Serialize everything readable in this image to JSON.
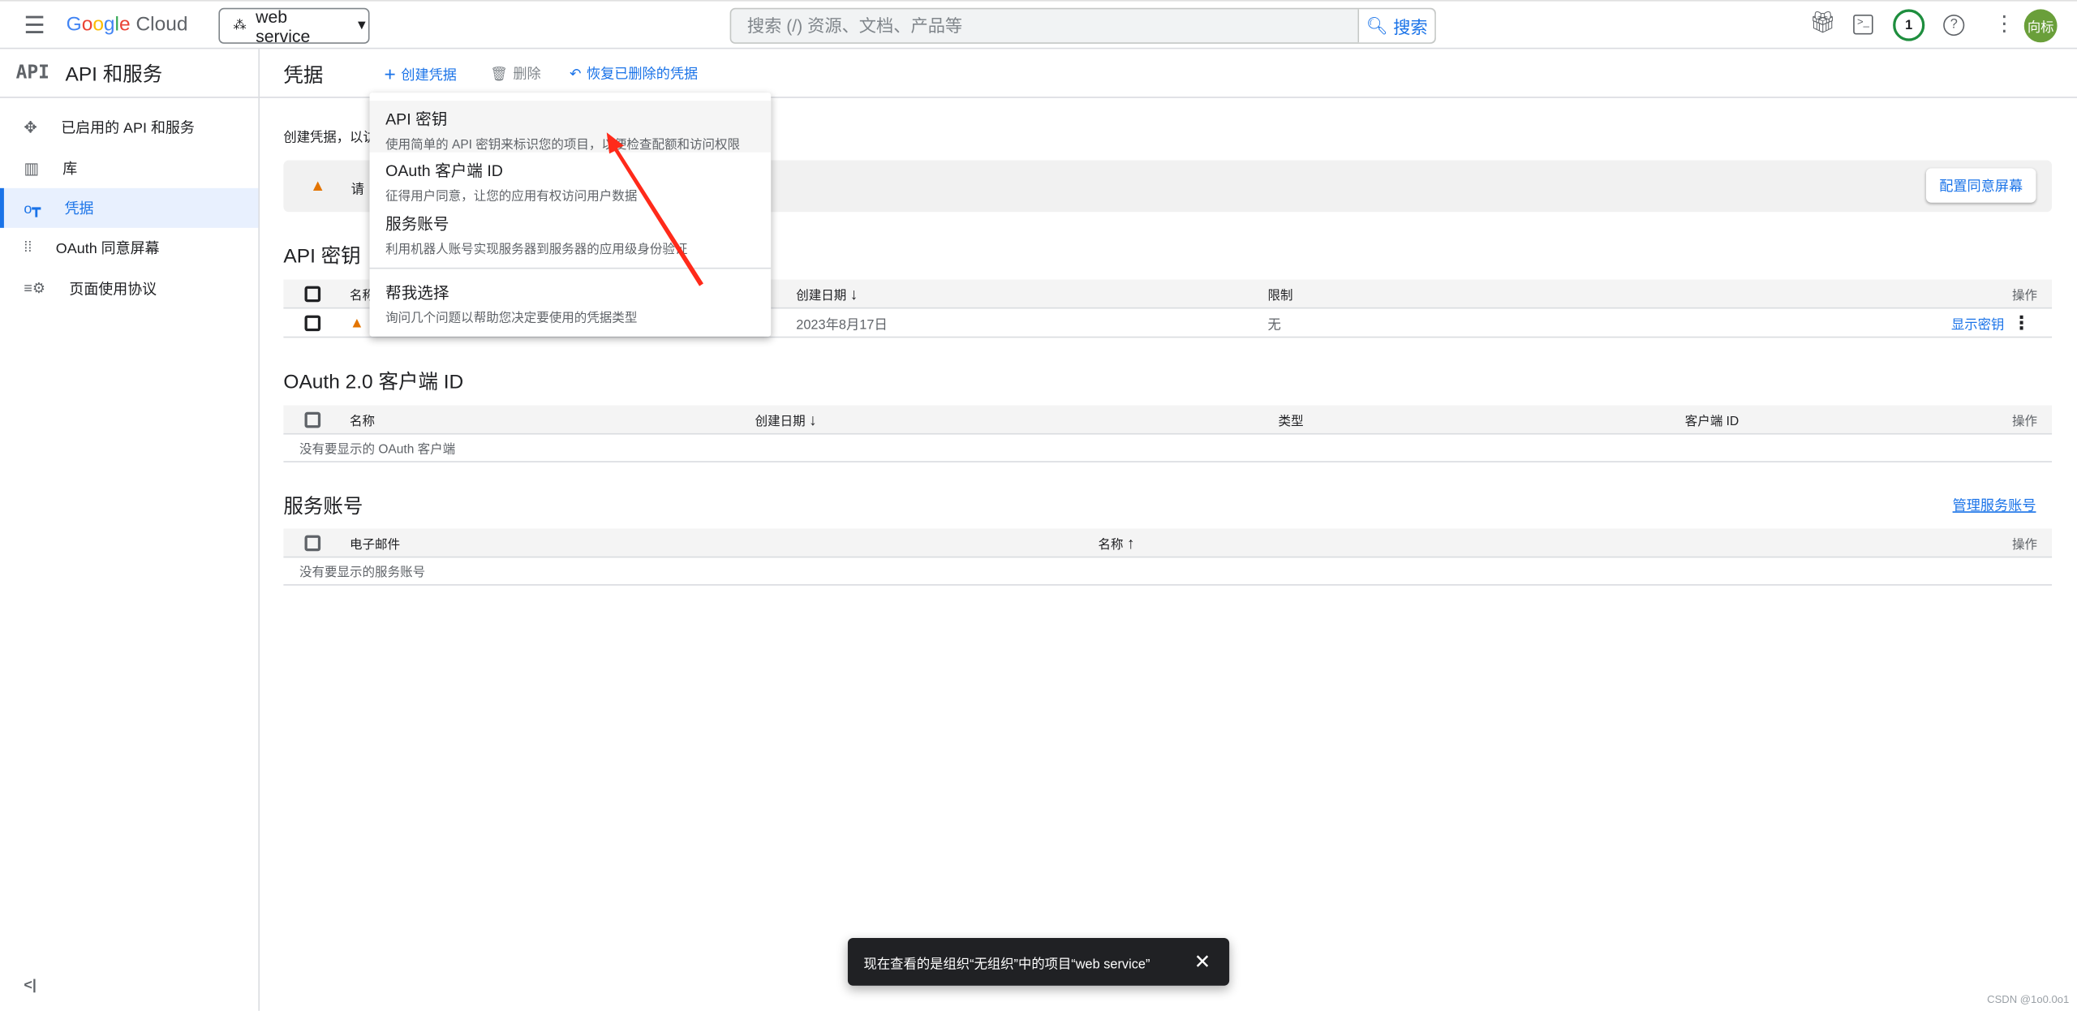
{
  "topbar": {
    "brand": "Google Cloud",
    "project": "web service",
    "search_placeholder": "搜索 (/) 资源、文档、产品等",
    "search_button": "搜索",
    "notification_count": "1",
    "avatar_text": "向标",
    "icons": [
      "menu-icon",
      "gift-icon",
      "terminal-icon",
      "help-icon",
      "more-vert-icon"
    ]
  },
  "sidebar": {
    "logo": "API",
    "title": "API 和服务",
    "items": [
      {
        "label": "已启用的 API 和服务",
        "icon": "enabled-apis-icon"
      },
      {
        "label": "库",
        "icon": "library-icon"
      },
      {
        "label": "凭据",
        "icon": "key-icon",
        "active": true
      },
      {
        "label": "OAuth 同意屏幕",
        "icon": "oauth-icon"
      },
      {
        "label": "页面使用协议",
        "icon": "settings-list-icon"
      }
    ],
    "collapse": "<|"
  },
  "main": {
    "title": "凭据",
    "toolbar": {
      "create": "创建凭据",
      "delete": "删除",
      "restore": "恢复已删除的凭据"
    },
    "intro": "创建凭据，以访",
    "banner": {
      "text": "请",
      "button": "配置同意屏幕"
    },
    "api_keys": {
      "heading": "API 密钥",
      "columns": [
        "名称",
        "创建日期",
        "限制",
        "操作"
      ],
      "rows": [
        {
          "date": "2023年8月17日",
          "restriction": "无",
          "action": "显示密钥"
        }
      ]
    },
    "oauth": {
      "heading": "OAuth 2.0 客户端 ID",
      "columns": [
        "名称",
        "创建日期",
        "类型",
        "客户端 ID",
        "操作"
      ],
      "empty": "没有要显示的 OAuth 客户端"
    },
    "service_accounts": {
      "heading": "服务账号",
      "manage": "管理服务账号",
      "columns": [
        "电子邮件",
        "名称",
        "操作"
      ],
      "empty": "没有要显示的服务账号"
    }
  },
  "menu": {
    "items": [
      {
        "title": "API 密钥",
        "desc": "使用简单的 API 密钥来标识您的项目，以便检查配额和访问权限"
      },
      {
        "title": "OAuth 客户端 ID",
        "desc": "征得用户同意，让您的应用有权访问用户数据"
      },
      {
        "title": "服务账号",
        "desc": "利用机器人账号实现服务器到服务器的应用级身份验证"
      },
      {
        "title": "帮我选择",
        "desc": "询问几个问题以帮助您决定要使用的凭据类型"
      }
    ]
  },
  "toast": {
    "text": "现在查看的是组织“无组织”中的项目“web service”"
  },
  "watermark": "CSDN @1o0.0o1",
  "colors": {
    "accent": "#1a73e8",
    "warning": "#e37400",
    "avatar": "#6a9f3a",
    "badge": "#1e8e3e",
    "arrow": "#ff2a1a"
  }
}
